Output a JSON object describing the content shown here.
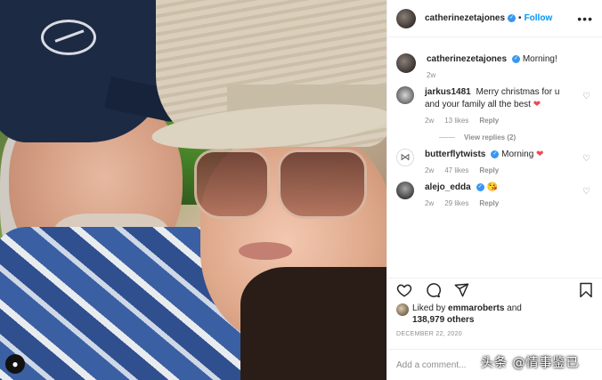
{
  "post": {
    "username": "catherinezetajones",
    "follow_label": "Follow",
    "separator": "•",
    "more_label": "•••"
  },
  "caption": {
    "username": "catherinezetajones",
    "text": "Morning!",
    "time": "2w"
  },
  "comments": [
    {
      "username": "jarkus1481",
      "text": "Merry christmas for u and your family all the best",
      "emoji": "❤",
      "time": "2w",
      "likes": "13 likes",
      "reply": "Reply",
      "verified": false
    },
    {
      "username": "butterflytwists",
      "text": "Morning",
      "emoji": "❤",
      "time": "2w",
      "likes": "47 likes",
      "reply": "Reply",
      "verified": true
    },
    {
      "username": "alejo_edda",
      "text": "",
      "emoji": "😘",
      "time": "2w",
      "likes": "29 likes",
      "reply": "Reply",
      "verified": true
    }
  ],
  "view_replies": "View replies (2)",
  "likes": {
    "prefix": "Liked by",
    "user": "emmaroberts",
    "joiner": "and",
    "count": "138,979 others"
  },
  "date": "DECEMBER 22, 2020",
  "add_comment_placeholder": "Add a comment...",
  "watermark": "头条 @情事鉴已",
  "icons": {
    "like": "heart-icon",
    "comment": "comment-icon",
    "share": "share-icon",
    "save": "bookmark-icon"
  },
  "colors": {
    "accent": "#0095f6",
    "verified": "#3897f0",
    "heart": "#ed4956",
    "muted": "#8e8e8e"
  }
}
